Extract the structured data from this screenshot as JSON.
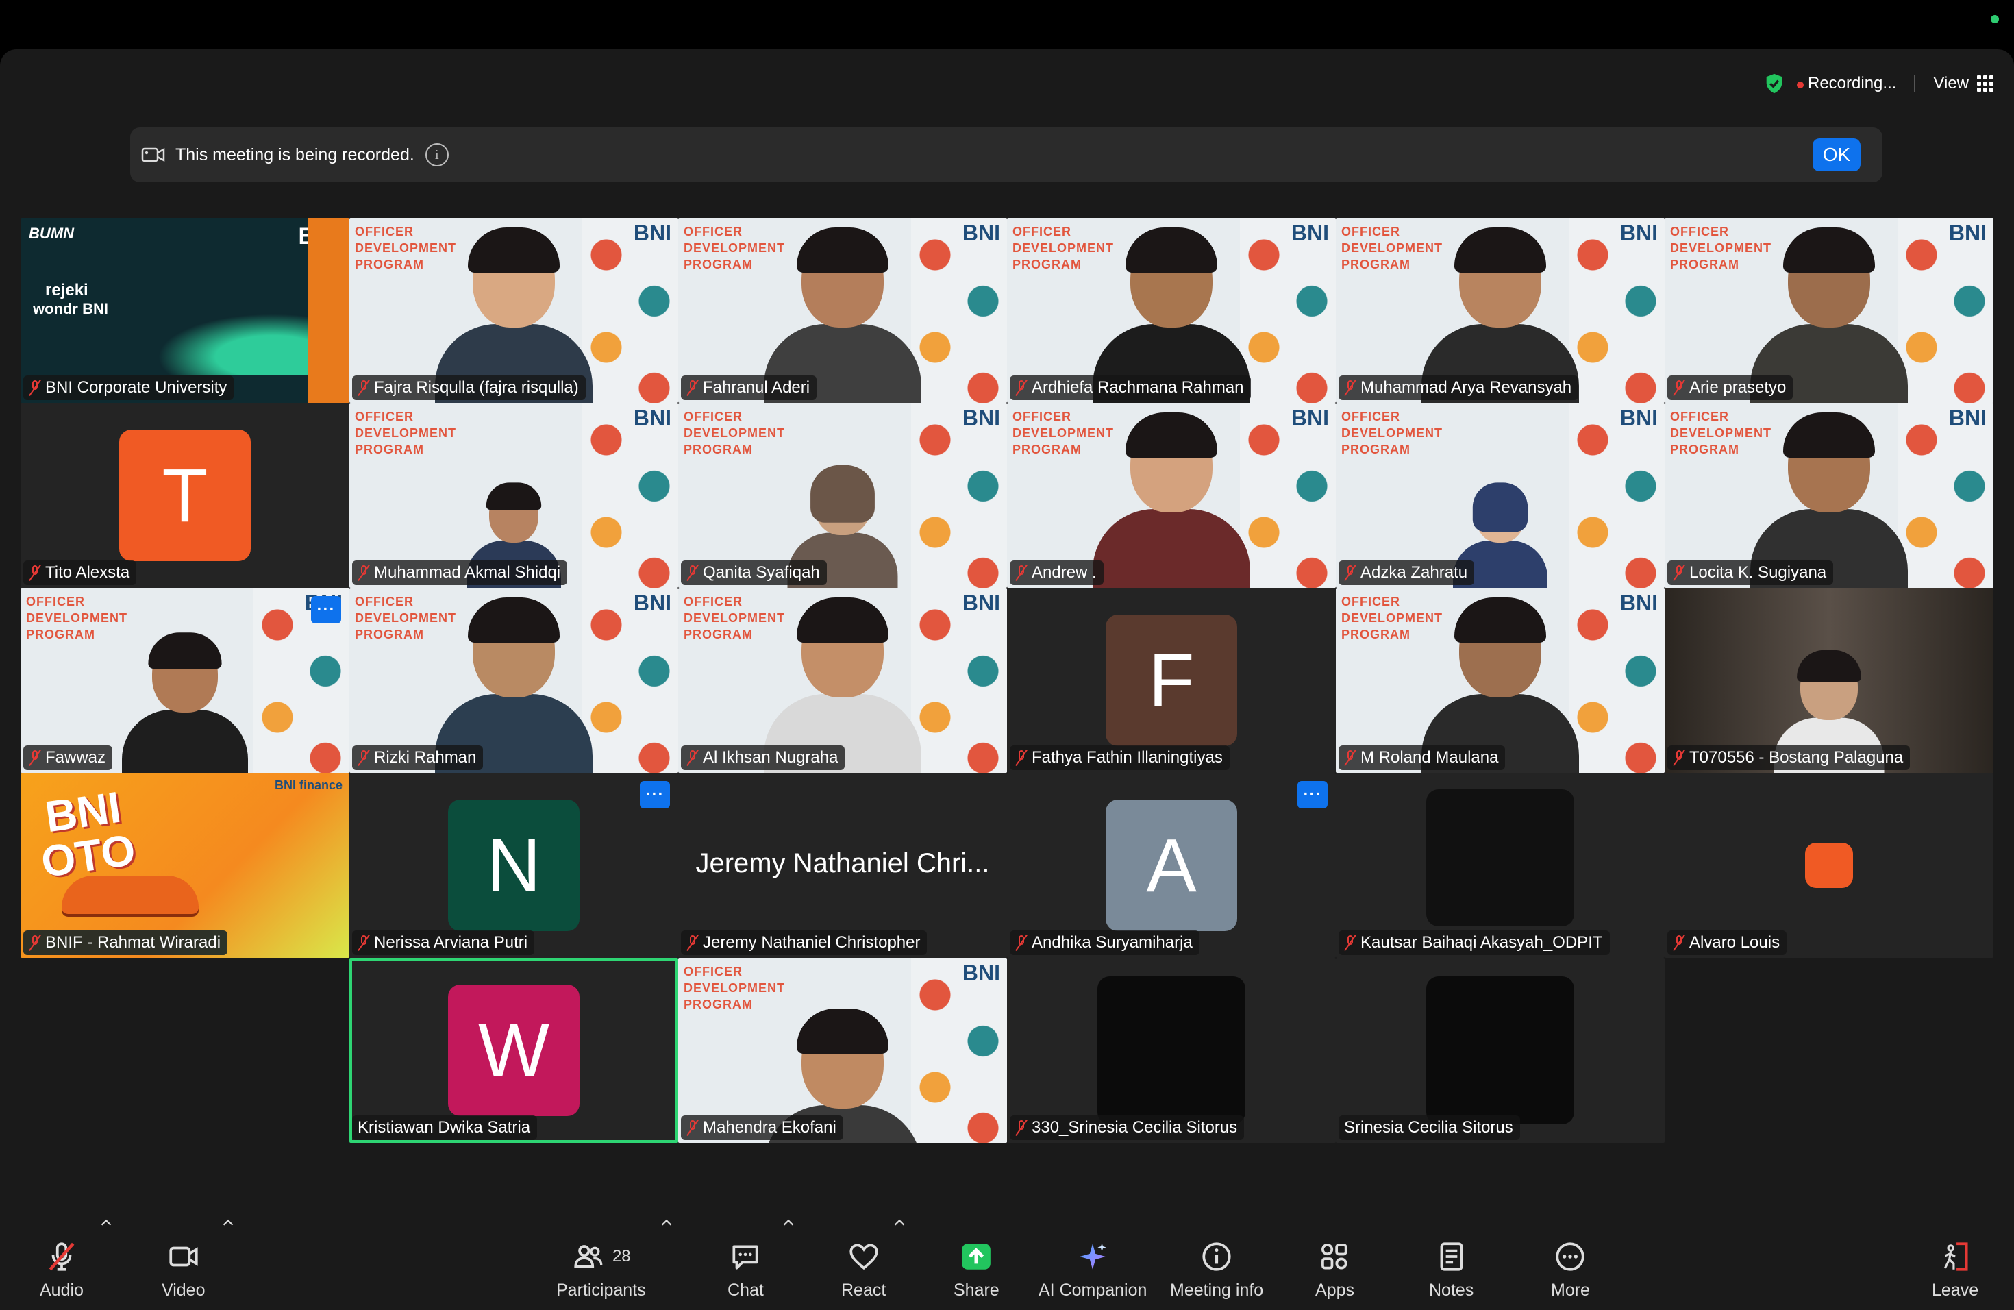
{
  "header": {
    "recording_label": "Recording...",
    "view_label": "View"
  },
  "banner": {
    "text": "This meeting is being recorded.",
    "ok_label": "OK"
  },
  "tiles": [
    {
      "name": "BNI Corporate University"
    },
    {
      "name": "Fajra Risqulla (fajra risqulla)"
    },
    {
      "name": "Fahranul Aderi"
    },
    {
      "name": "Ardhiefa Rachmana Rahman"
    },
    {
      "name": "Muhammad Arya Revansyah"
    },
    {
      "name": "Arie prasetyo"
    },
    {
      "name": "Tito Alexsta",
      "initial": "T",
      "color": "#f05a24"
    },
    {
      "name": "Muhammad Akmal Shidqi"
    },
    {
      "name": "Qanita Syafiqah"
    },
    {
      "name": "Andrew ."
    },
    {
      "name": "Adzka Zahratu"
    },
    {
      "name": "Locita K. Sugiyana"
    },
    {
      "name": "Fawwaz"
    },
    {
      "name": "Rizki Rahman"
    },
    {
      "name": "Al Ikhsan Nugraha"
    },
    {
      "name": "Fathya Fathin Illaningtiyas",
      "initial": "F",
      "color": "#5a3a2e"
    },
    {
      "name": "M Roland Maulana"
    },
    {
      "name": "T070556 - Bostang Palaguna"
    },
    {
      "name": "BNIF - Rahmat Wiraradi"
    },
    {
      "name": "Nerissa Arviana Putri",
      "initial": "N",
      "color": "#0b4d3c"
    },
    {
      "name": "Jeremy Nathaniel Christopher",
      "display": "Jeremy Nathaniel Chri..."
    },
    {
      "name": "Andhika Suryamiharja",
      "initial": "A",
      "color": "#7a8a99"
    },
    {
      "name": "Kautsar Baihaqi Akasyah_ODPIT"
    },
    {
      "name": "Alvaro Louis"
    },
    {
      "name": "Kristiawan Dwika Satria",
      "initial": "W",
      "color": "#c2185b"
    },
    {
      "name": "Mahendra Ekofani"
    },
    {
      "name": "330_Srinesia Cecilia Sitorus"
    },
    {
      "name": "Srinesia Cecilia Sitorus"
    }
  ],
  "odp": {
    "line1": "OFFICER",
    "line2": "DEVELOPMENT",
    "line3": "PROGRAM",
    "bni": "BNI"
  },
  "bni_cu": {
    "bumn": "BUMN",
    "bni": "BNI",
    "rejeki": "rejeki",
    "wondr": "wondr BNI"
  },
  "bnif": {
    "line1": "BNI",
    "line2": "OTO",
    "brand": "BNI finance"
  },
  "toolbar": {
    "audio": "Audio",
    "video": "Video",
    "participants": "Participants",
    "participants_count": "28",
    "chat": "Chat",
    "react": "React",
    "share": "Share",
    "ai_companion": "AI Companion",
    "meeting_info": "Meeting info",
    "apps": "Apps",
    "notes": "Notes",
    "more": "More",
    "leave": "Leave"
  },
  "colors": {
    "accent": "#0e72ed",
    "share_green": "#22c55e",
    "mute_red": "#e53935",
    "active_speaker": "#2ed573"
  }
}
